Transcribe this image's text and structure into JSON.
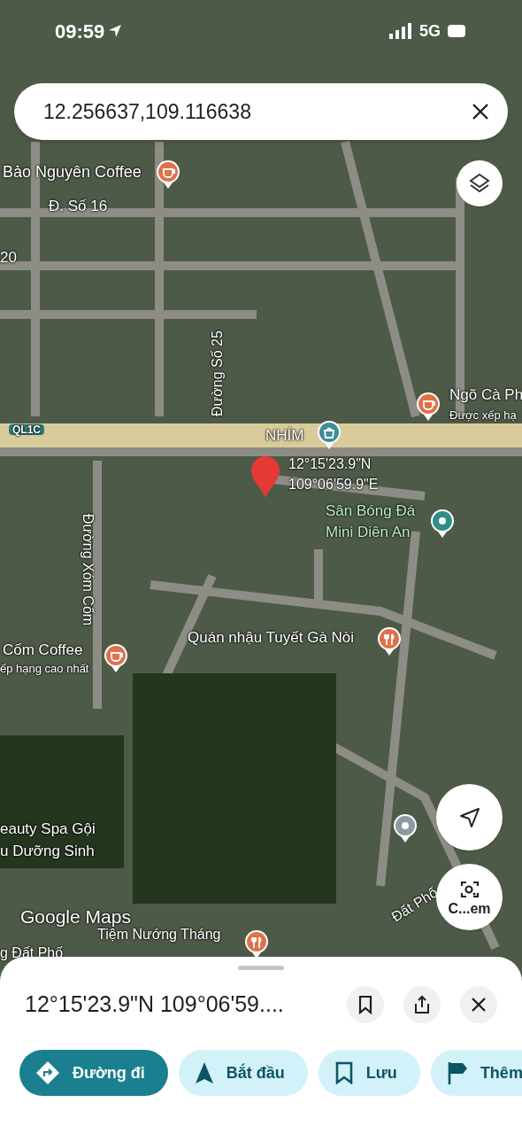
{
  "status_bar": {
    "time": "09:59",
    "network": "5G"
  },
  "search": {
    "value": "12.256637,109.116638"
  },
  "map": {
    "labels": [
      {
        "text": "Bảo Nguyên Coffee",
        "kind": "poi"
      },
      {
        "text": "Đ. Số 16",
        "kind": "road"
      },
      {
        "text": "20",
        "kind": "road"
      },
      {
        "text": "Đường Số 25",
        "kind": "road"
      },
      {
        "text": "Ngõ Cà Ph",
        "kind": "poi"
      },
      {
        "text": "Được xếp hạ",
        "kind": "subtitle"
      },
      {
        "text": "QL1C",
        "kind": "shield"
      },
      {
        "text": "NHÍM",
        "kind": "poi"
      },
      {
        "text": "12°15'23.9\"N",
        "kind": "coords"
      },
      {
        "text": "109°06'59.9\"E",
        "kind": "coords"
      },
      {
        "text": "Sân Bóng Đá",
        "kind": "park"
      },
      {
        "text": "Mini Diên An",
        "kind": "park"
      },
      {
        "text": "Đường Xóm Cốm",
        "kind": "road"
      },
      {
        "text": "Quán nhậu Tuyết Gà Nòi",
        "kind": "poi"
      },
      {
        "text": "Cốm Coffee",
        "kind": "poi"
      },
      {
        "text": "ếp hạng cao nhất",
        "kind": "subtitle"
      },
      {
        "text": "eauty Spa Gội",
        "kind": "poi"
      },
      {
        "text": "u Dưỡng Sinh",
        "kind": "poi"
      },
      {
        "text": "Google Maps",
        "kind": "brand"
      },
      {
        "text": "Tiệm Nướng Tháng",
        "kind": "poi"
      },
      {
        "text": "g Đất Phố",
        "kind": "road"
      },
      {
        "text": "Đất Phố",
        "kind": "road"
      }
    ],
    "pins": [
      {
        "kind": "cafe"
      },
      {
        "kind": "cafe"
      },
      {
        "kind": "shop"
      },
      {
        "kind": "dropped"
      },
      {
        "kind": "sport"
      },
      {
        "kind": "restaurant"
      },
      {
        "kind": "cafe"
      },
      {
        "kind": "generic"
      },
      {
        "kind": "restaurant"
      }
    ],
    "lens_button": {
      "label": "C...em"
    }
  },
  "place_sheet": {
    "title": "12°15'23.9\"N 109°06'59....",
    "actions": [
      {
        "label": "Đường đi",
        "kind": "directions",
        "primary": true
      },
      {
        "label": "Bắt đầu",
        "kind": "start",
        "primary": false
      },
      {
        "label": "Lưu",
        "kind": "save",
        "primary": false
      },
      {
        "label": "Thêm",
        "kind": "flag",
        "primary": false
      }
    ]
  }
}
